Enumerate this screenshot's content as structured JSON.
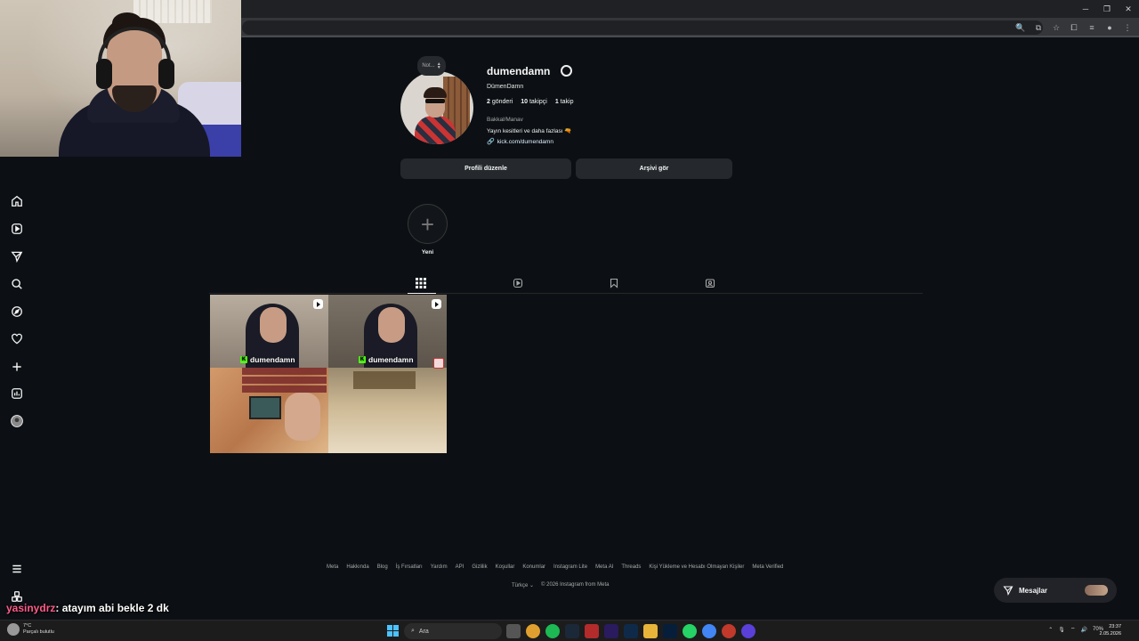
{
  "profile": {
    "username": "dumendamn",
    "full_name": "DümenDamn",
    "note_label": "Not...",
    "posts_count": "2",
    "posts_label": "gönderi",
    "followers_count": "10",
    "followers_label": "takipçi",
    "following_count": "1",
    "following_label": "takip",
    "category": "Bakkal/Manav",
    "bio": "Yayın kesitleri ve daha fazlası 🔫",
    "link": "kick.com/dumendamn"
  },
  "buttons": {
    "edit_profile": "Profili düzenle",
    "view_archive": "Arşivi gör"
  },
  "highlight": {
    "new_label": "Yeni"
  },
  "posts": [
    {
      "tag": "dumendamn",
      "type": "reel"
    },
    {
      "tag": "dumendamn",
      "type": "reel"
    }
  ],
  "footer": {
    "links": [
      "Meta",
      "Hakkında",
      "Blog",
      "İş Fırsatları",
      "Yardım",
      "API",
      "Gizlilik",
      "Koşullar",
      "Konumlar",
      "Instagram Lite",
      "Meta AI",
      "Threads",
      "Kişi Yükleme ve Hesabı Olmayan Kişiler",
      "Meta Verified"
    ],
    "language": "Türkçe",
    "copyright": "© 2026 Instagram from Meta"
  },
  "messages": {
    "label": "Mesajlar"
  },
  "chat_overlay": {
    "user": "yasinydrz",
    "message": ": atayım abi bekle 2 dk"
  },
  "taskbar": {
    "weather_temp": "7°C",
    "weather_desc": "Parçalı bulutlu",
    "search_placeholder": "Ara",
    "battery": "70%",
    "time": "23:37",
    "date": "2.05.2026"
  },
  "colors": {
    "background": "#0c1014",
    "button_bg": "#25292e",
    "kick_green": "#53fc18",
    "chat_user": "#ff5c8a"
  },
  "icons": [
    "home-icon",
    "reels-icon",
    "send-icon",
    "search-icon",
    "explore-icon",
    "heart-icon",
    "create-icon",
    "insights-icon",
    "profile-icon",
    "menu-icon",
    "threads-icon",
    "grid-icon",
    "tagged-icon",
    "saved-icon"
  ]
}
